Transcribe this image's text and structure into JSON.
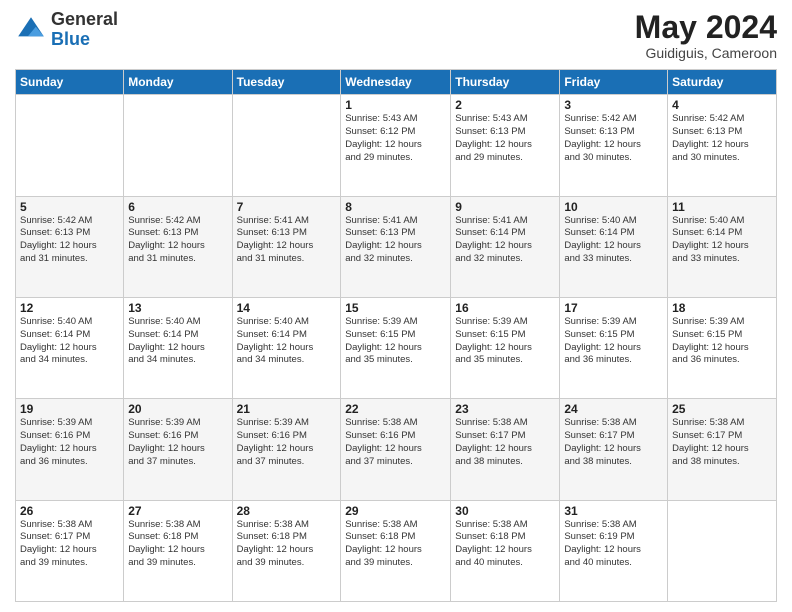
{
  "header": {
    "logo_general": "General",
    "logo_blue": "Blue",
    "month_title": "May 2024",
    "location": "Guidiguis, Cameroon"
  },
  "weekdays": [
    "Sunday",
    "Monday",
    "Tuesday",
    "Wednesday",
    "Thursday",
    "Friday",
    "Saturday"
  ],
  "weeks": [
    [
      {
        "day": "",
        "info": ""
      },
      {
        "day": "",
        "info": ""
      },
      {
        "day": "",
        "info": ""
      },
      {
        "day": "1",
        "info": "Sunrise: 5:43 AM\nSunset: 6:12 PM\nDaylight: 12 hours\nand 29 minutes."
      },
      {
        "day": "2",
        "info": "Sunrise: 5:43 AM\nSunset: 6:13 PM\nDaylight: 12 hours\nand 29 minutes."
      },
      {
        "day": "3",
        "info": "Sunrise: 5:42 AM\nSunset: 6:13 PM\nDaylight: 12 hours\nand 30 minutes."
      },
      {
        "day": "4",
        "info": "Sunrise: 5:42 AM\nSunset: 6:13 PM\nDaylight: 12 hours\nand 30 minutes."
      }
    ],
    [
      {
        "day": "5",
        "info": "Sunrise: 5:42 AM\nSunset: 6:13 PM\nDaylight: 12 hours\nand 31 minutes."
      },
      {
        "day": "6",
        "info": "Sunrise: 5:42 AM\nSunset: 6:13 PM\nDaylight: 12 hours\nand 31 minutes."
      },
      {
        "day": "7",
        "info": "Sunrise: 5:41 AM\nSunset: 6:13 PM\nDaylight: 12 hours\nand 31 minutes."
      },
      {
        "day": "8",
        "info": "Sunrise: 5:41 AM\nSunset: 6:13 PM\nDaylight: 12 hours\nand 32 minutes."
      },
      {
        "day": "9",
        "info": "Sunrise: 5:41 AM\nSunset: 6:14 PM\nDaylight: 12 hours\nand 32 minutes."
      },
      {
        "day": "10",
        "info": "Sunrise: 5:40 AM\nSunset: 6:14 PM\nDaylight: 12 hours\nand 33 minutes."
      },
      {
        "day": "11",
        "info": "Sunrise: 5:40 AM\nSunset: 6:14 PM\nDaylight: 12 hours\nand 33 minutes."
      }
    ],
    [
      {
        "day": "12",
        "info": "Sunrise: 5:40 AM\nSunset: 6:14 PM\nDaylight: 12 hours\nand 34 minutes."
      },
      {
        "day": "13",
        "info": "Sunrise: 5:40 AM\nSunset: 6:14 PM\nDaylight: 12 hours\nand 34 minutes."
      },
      {
        "day": "14",
        "info": "Sunrise: 5:40 AM\nSunset: 6:14 PM\nDaylight: 12 hours\nand 34 minutes."
      },
      {
        "day": "15",
        "info": "Sunrise: 5:39 AM\nSunset: 6:15 PM\nDaylight: 12 hours\nand 35 minutes."
      },
      {
        "day": "16",
        "info": "Sunrise: 5:39 AM\nSunset: 6:15 PM\nDaylight: 12 hours\nand 35 minutes."
      },
      {
        "day": "17",
        "info": "Sunrise: 5:39 AM\nSunset: 6:15 PM\nDaylight: 12 hours\nand 36 minutes."
      },
      {
        "day": "18",
        "info": "Sunrise: 5:39 AM\nSunset: 6:15 PM\nDaylight: 12 hours\nand 36 minutes."
      }
    ],
    [
      {
        "day": "19",
        "info": "Sunrise: 5:39 AM\nSunset: 6:16 PM\nDaylight: 12 hours\nand 36 minutes."
      },
      {
        "day": "20",
        "info": "Sunrise: 5:39 AM\nSunset: 6:16 PM\nDaylight: 12 hours\nand 37 minutes."
      },
      {
        "day": "21",
        "info": "Sunrise: 5:39 AM\nSunset: 6:16 PM\nDaylight: 12 hours\nand 37 minutes."
      },
      {
        "day": "22",
        "info": "Sunrise: 5:38 AM\nSunset: 6:16 PM\nDaylight: 12 hours\nand 37 minutes."
      },
      {
        "day": "23",
        "info": "Sunrise: 5:38 AM\nSunset: 6:17 PM\nDaylight: 12 hours\nand 38 minutes."
      },
      {
        "day": "24",
        "info": "Sunrise: 5:38 AM\nSunset: 6:17 PM\nDaylight: 12 hours\nand 38 minutes."
      },
      {
        "day": "25",
        "info": "Sunrise: 5:38 AM\nSunset: 6:17 PM\nDaylight: 12 hours\nand 38 minutes."
      }
    ],
    [
      {
        "day": "26",
        "info": "Sunrise: 5:38 AM\nSunset: 6:17 PM\nDaylight: 12 hours\nand 39 minutes."
      },
      {
        "day": "27",
        "info": "Sunrise: 5:38 AM\nSunset: 6:18 PM\nDaylight: 12 hours\nand 39 minutes."
      },
      {
        "day": "28",
        "info": "Sunrise: 5:38 AM\nSunset: 6:18 PM\nDaylight: 12 hours\nand 39 minutes."
      },
      {
        "day": "29",
        "info": "Sunrise: 5:38 AM\nSunset: 6:18 PM\nDaylight: 12 hours\nand 39 minutes."
      },
      {
        "day": "30",
        "info": "Sunrise: 5:38 AM\nSunset: 6:18 PM\nDaylight: 12 hours\nand 40 minutes."
      },
      {
        "day": "31",
        "info": "Sunrise: 5:38 AM\nSunset: 6:19 PM\nDaylight: 12 hours\nand 40 minutes."
      },
      {
        "day": "",
        "info": ""
      }
    ]
  ]
}
